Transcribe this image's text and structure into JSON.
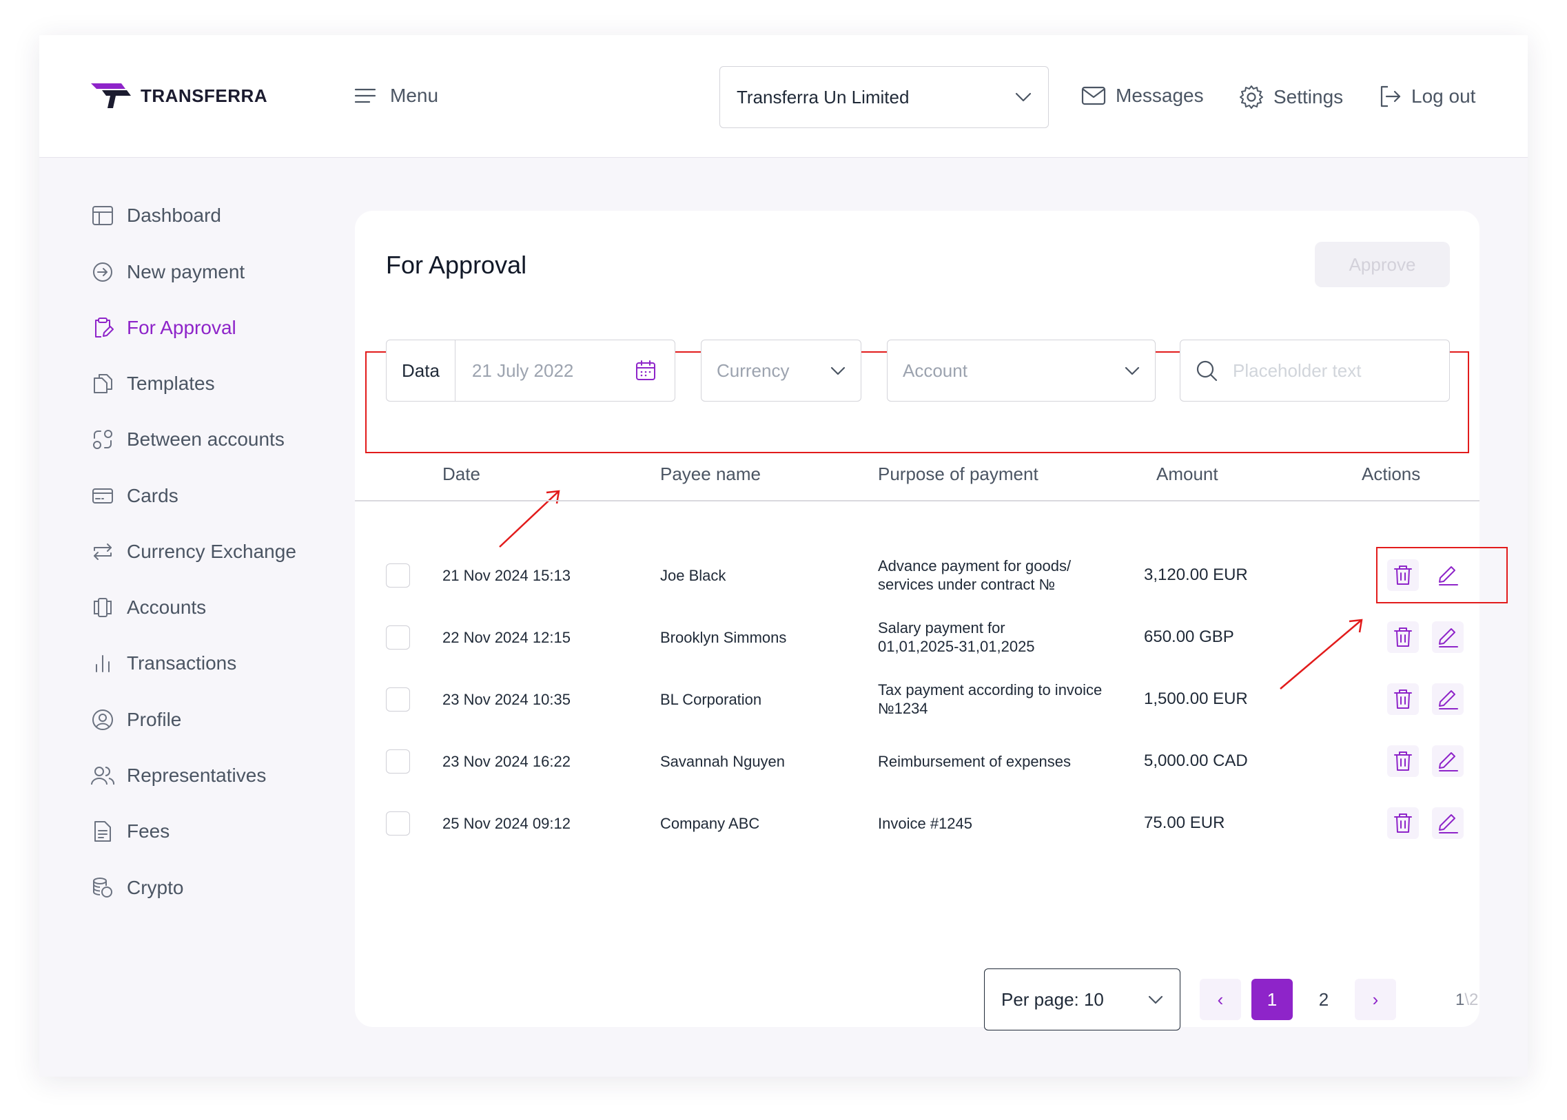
{
  "header": {
    "logo_text": "TRANSFERRA",
    "menu_label": "Menu",
    "company": "Transferra Un Limited",
    "messages_label": "Messages",
    "settings_label": "Settings",
    "logout_label": "Log out"
  },
  "sidebar": {
    "items": [
      {
        "label": "Dashboard",
        "icon": "layout-icon"
      },
      {
        "label": "New payment",
        "icon": "arrow-circle-icon"
      },
      {
        "label": "For Approval",
        "icon": "clipboard-icon",
        "active": true
      },
      {
        "label": "Templates",
        "icon": "copy-icon"
      },
      {
        "label": "Between accounts",
        "icon": "transfer-icon"
      },
      {
        "label": "Cards",
        "icon": "card-icon"
      },
      {
        "label": "Currency Exchange",
        "icon": "exchange-icon"
      },
      {
        "label": "Accounts",
        "icon": "accounts-icon"
      },
      {
        "label": "Transactions",
        "icon": "bars-icon"
      },
      {
        "label": "Profile",
        "icon": "user-circle-icon"
      },
      {
        "label": "Representatives",
        "icon": "users-icon"
      },
      {
        "label": "Fees",
        "icon": "document-icon"
      },
      {
        "label": "Crypto",
        "icon": "coins-icon"
      }
    ]
  },
  "main": {
    "title": "For Approval",
    "approve_label": "Approve",
    "filters": {
      "date_label": "Data",
      "date_value": "21 July 2022",
      "currency_placeholder": "Currency",
      "account_placeholder": "Account",
      "search_placeholder": "Placeholder text"
    },
    "columns": [
      "Date",
      "Payee name",
      "Purpose of payment",
      "Amount",
      "Actions"
    ],
    "rows": [
      {
        "date": "21 Nov 2024  15:13",
        "payee": "Joe Black",
        "purpose_line1": "Advance payment for goods/",
        "purpose_line2": "services under contract №",
        "amount": "3,120.00 EUR"
      },
      {
        "date": "22 Nov 2024  12:15",
        "payee": "Brooklyn Simmons",
        "purpose_line1": "Salary payment for",
        "purpose_line2": "01,01,2025-31,01,2025",
        "amount": "650.00 GBP"
      },
      {
        "date": "23 Nov 2024  10:35",
        "payee": "BL Corporation",
        "purpose_line1": "Tax payment according to invoice",
        "purpose_line2": "№1234",
        "amount": "1,500.00 EUR"
      },
      {
        "date": "23 Nov 2024  16:22",
        "payee": "Savannah Nguyen",
        "purpose_line1": "Reimbursement of expenses",
        "purpose_line2": "",
        "amount": "5,000.00 CAD"
      },
      {
        "date": "25 Nov 2024  09:12",
        "payee": "Company ABC",
        "purpose_line1": "Invoice #1245",
        "purpose_line2": "",
        "amount": "75.00 EUR"
      }
    ]
  },
  "pagination": {
    "per_page_label": "Per page: 10",
    "prev": "‹",
    "next": "›",
    "pages": [
      "1",
      "2"
    ],
    "current_page": "1",
    "count_current": "1",
    "count_sep": "\\",
    "count_total": "2"
  },
  "colors": {
    "accent": "#8E24C9",
    "annotation": "#E21B1B",
    "text": "#1F2937",
    "muted": "#4B5563"
  }
}
